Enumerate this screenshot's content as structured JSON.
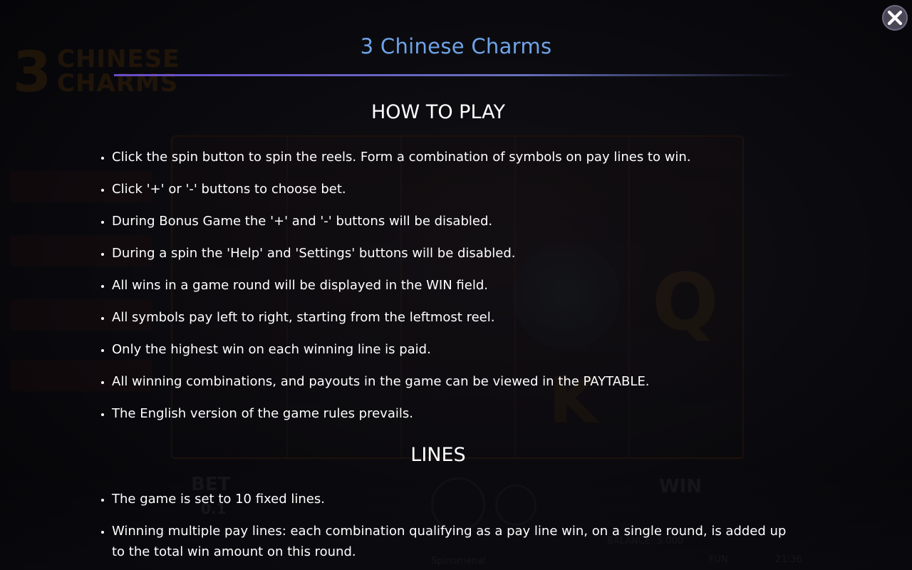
{
  "modal": {
    "title": "3 Chinese Charms",
    "close_icon": "close-icon"
  },
  "how_to_play": {
    "heading": "HOW TO PLAY",
    "items": [
      "Click the spin button to spin the reels. Form a combination of symbols on pay lines to win.",
      "Click '+' or '-' buttons to choose bet.",
      "During Bonus Game the '+' and '-' buttons will be disabled.",
      "During a spin the 'Help' and 'Settings' buttons will be disabled.",
      "All wins in a game round will be displayed in the WIN field.",
      "All symbols pay left to right, starting from the leftmost reel.",
      "Only the highest win on each winning line is paid.",
      "All winning combinations, and payouts in the game can be viewed in the PAYTABLE.",
      "The English version of the game rules prevails."
    ]
  },
  "lines": {
    "heading": "LINES",
    "items": [
      "The game is set to 10 fixed lines.",
      "Winning multiple pay lines: each combination qualifying as a pay line win, on a single round, is added up to the total win amount on this round."
    ]
  },
  "background": {
    "logo_number": "3",
    "logo_word1": "CHINESE",
    "logo_word2": "CHARMS",
    "bet_label": "BET",
    "bet_value": "0.1",
    "win_label": "WIN",
    "balance_text": "BALANCE: 5,000",
    "mode_text": "FUN",
    "clock_text": "21:36",
    "brand_text": "Spinomenal"
  },
  "colors": {
    "title": "#6fa3e8",
    "text": "#ffffff",
    "close_button": "#4a4656"
  }
}
